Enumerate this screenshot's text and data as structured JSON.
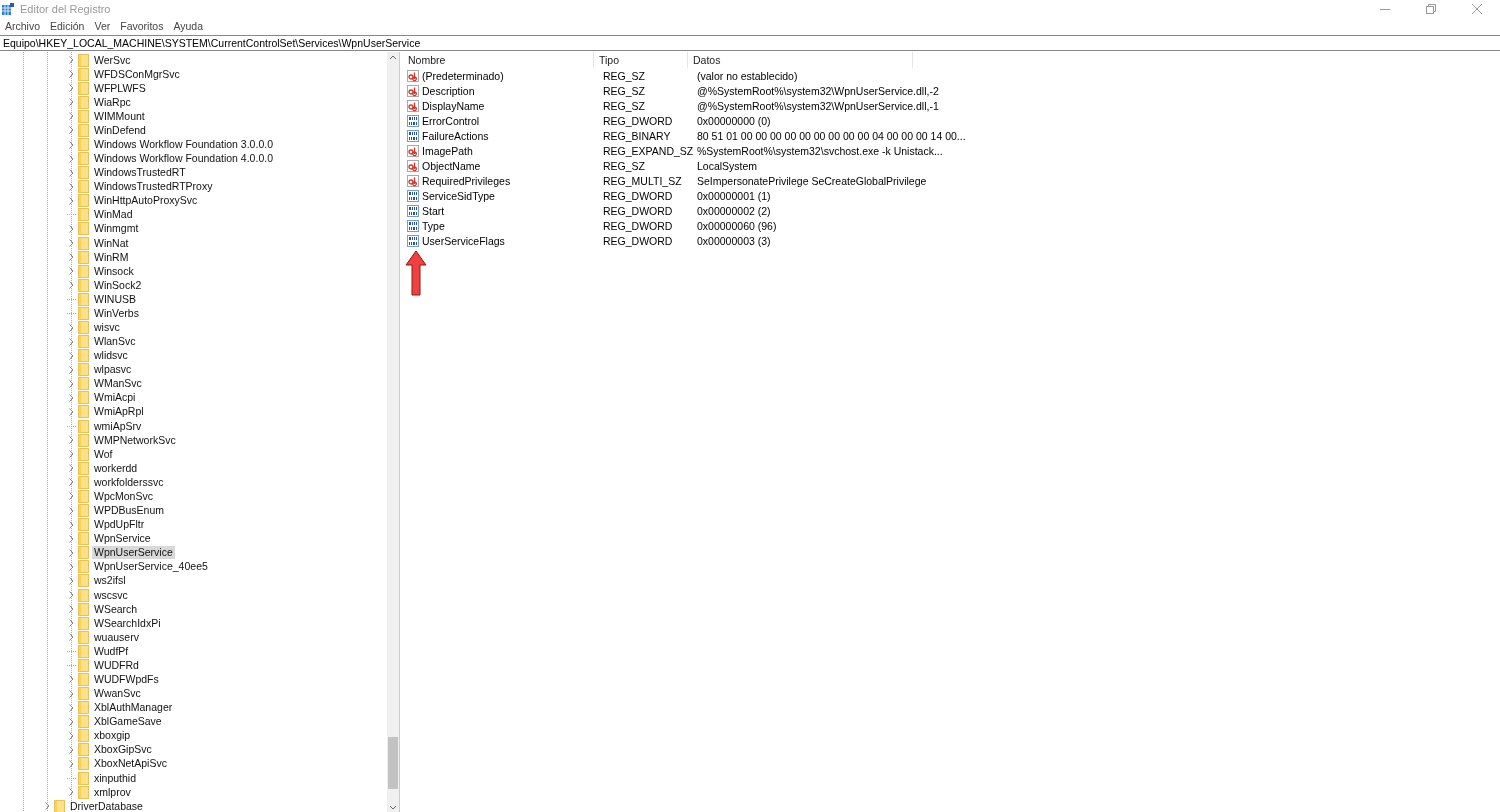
{
  "window": {
    "title": "Editor del Registro"
  },
  "menu": [
    "Archivo",
    "Edición",
    "Ver",
    "Favoritos",
    "Ayuda"
  ],
  "address": "Equipo\\HKEY_LOCAL_MACHINE\\SYSTEM\\CurrentControlSet\\Services\\WpnUserService",
  "tree": [
    {
      "children": [
        {
          "label": "WerSvc",
          "expandable": true,
          "selected": false
        },
        {
          "label": "WFDSConMgrSvc",
          "expandable": true,
          "selected": false
        },
        {
          "label": "WFPLWFS",
          "expandable": true,
          "selected": false
        },
        {
          "label": "WiaRpc",
          "expandable": true,
          "selected": false
        },
        {
          "label": "WIMMount",
          "expandable": true,
          "selected": false
        },
        {
          "label": "WinDefend",
          "expandable": true,
          "selected": false
        },
        {
          "label": "Windows Workflow Foundation 3.0.0.0",
          "expandable": true,
          "selected": false
        },
        {
          "label": "Windows Workflow Foundation 4.0.0.0",
          "expandable": true,
          "selected": false
        },
        {
          "label": "WindowsTrustedRT",
          "expandable": true,
          "selected": false
        },
        {
          "label": "WindowsTrustedRTProxy",
          "expandable": true,
          "selected": false
        },
        {
          "label": "WinHttpAutoProxySvc",
          "expandable": true,
          "selected": false
        },
        {
          "label": "WinMad",
          "expandable": false,
          "selected": false
        },
        {
          "label": "Winmgmt",
          "expandable": true,
          "selected": false
        },
        {
          "label": "WinNat",
          "expandable": true,
          "selected": false
        },
        {
          "label": "WinRM",
          "expandable": true,
          "selected": false
        },
        {
          "label": "Winsock",
          "expandable": true,
          "selected": false
        },
        {
          "label": "WinSock2",
          "expandable": true,
          "selected": false
        },
        {
          "label": "WINUSB",
          "expandable": false,
          "selected": false
        },
        {
          "label": "WinVerbs",
          "expandable": false,
          "selected": false
        },
        {
          "label": "wisvc",
          "expandable": true,
          "selected": false
        },
        {
          "label": "WlanSvc",
          "expandable": true,
          "selected": false
        },
        {
          "label": "wlidsvc",
          "expandable": true,
          "selected": false
        },
        {
          "label": "wlpasvc",
          "expandable": true,
          "selected": false
        },
        {
          "label": "WManSvc",
          "expandable": true,
          "selected": false
        },
        {
          "label": "WmiAcpi",
          "expandable": true,
          "selected": false
        },
        {
          "label": "WmiApRpl",
          "expandable": true,
          "selected": false
        },
        {
          "label": "wmiApSrv",
          "expandable": false,
          "selected": false
        },
        {
          "label": "WMPNetworkSvc",
          "expandable": true,
          "selected": false
        },
        {
          "label": "Wof",
          "expandable": true,
          "selected": false
        },
        {
          "label": "workerdd",
          "expandable": true,
          "selected": false
        },
        {
          "label": "workfolderssvc",
          "expandable": true,
          "selected": false
        },
        {
          "label": "WpcMonSvc",
          "expandable": true,
          "selected": false
        },
        {
          "label": "WPDBusEnum",
          "expandable": true,
          "selected": false
        },
        {
          "label": "WpdUpFltr",
          "expandable": true,
          "selected": false
        },
        {
          "label": "WpnService",
          "expandable": true,
          "selected": false
        },
        {
          "label": "WpnUserService",
          "expandable": true,
          "selected": true
        },
        {
          "label": "WpnUserService_40ee5",
          "expandable": true,
          "selected": false
        },
        {
          "label": "ws2ifsl",
          "expandable": true,
          "selected": false
        },
        {
          "label": "wscsvc",
          "expandable": true,
          "selected": false
        },
        {
          "label": "WSearch",
          "expandable": true,
          "selected": false
        },
        {
          "label": "WSearchIdxPi",
          "expandable": true,
          "selected": false
        },
        {
          "label": "wuauserv",
          "expandable": true,
          "selected": false
        },
        {
          "label": "WudfPf",
          "expandable": false,
          "selected": false
        },
        {
          "label": "WUDFRd",
          "expandable": false,
          "selected": false
        },
        {
          "label": "WUDFWpdFs",
          "expandable": true,
          "selected": false
        },
        {
          "label": "WwanSvc",
          "expandable": true,
          "selected": false
        },
        {
          "label": "XblAuthManager",
          "expandable": true,
          "selected": false
        },
        {
          "label": "XblGameSave",
          "expandable": true,
          "selected": false
        },
        {
          "label": "xboxgip",
          "expandable": true,
          "selected": false
        },
        {
          "label": "XboxGipSvc",
          "expandable": true,
          "selected": false
        },
        {
          "label": "XboxNetApiSvc",
          "expandable": true,
          "selected": false
        },
        {
          "label": "xinputhid",
          "expandable": false,
          "selected": false
        },
        {
          "label": "xmlprov",
          "expandable": true,
          "selected": false
        }
      ]
    },
    {
      "label": "DriverDatabase",
      "expandable": true,
      "selected": false
    }
  ],
  "table": {
    "columns": [
      "Nombre",
      "Tipo",
      "Datos"
    ],
    "rows": [
      {
        "kind": "string",
        "name": "(Predeterminado)",
        "type": "REG_SZ",
        "data": "(valor no establecido)"
      },
      {
        "kind": "string",
        "name": "Description",
        "type": "REG_SZ",
        "data": "@%SystemRoot%\\system32\\WpnUserService.dll,-2"
      },
      {
        "kind": "string",
        "name": "DisplayName",
        "type": "REG_SZ",
        "data": "@%SystemRoot%\\system32\\WpnUserService.dll,-1"
      },
      {
        "kind": "binary",
        "name": "ErrorControl",
        "type": "REG_DWORD",
        "data": "0x00000000 (0)"
      },
      {
        "kind": "binary",
        "name": "FailureActions",
        "type": "REG_BINARY",
        "data": "80 51 01 00 00 00 00 00 00 00 00 00 04 00 00 00 14 00..."
      },
      {
        "kind": "string",
        "name": "ImagePath",
        "type": "REG_EXPAND_SZ",
        "data": "%SystemRoot%\\system32\\svchost.exe -k Unistack..."
      },
      {
        "kind": "string",
        "name": "ObjectName",
        "type": "REG_SZ",
        "data": "LocalSystem"
      },
      {
        "kind": "string",
        "name": "RequiredPrivileges",
        "type": "REG_MULTI_SZ",
        "data": "SeImpersonatePrivilege SeCreateGlobalPrivilege"
      },
      {
        "kind": "binary",
        "name": "ServiceSidType",
        "type": "REG_DWORD",
        "data": "0x00000001 (1)"
      },
      {
        "kind": "binary",
        "name": "Start",
        "type": "REG_DWORD",
        "data": "0x00000002 (2)"
      },
      {
        "kind": "binary",
        "name": "Type",
        "type": "REG_DWORD",
        "data": "0x00000060 (96)"
      },
      {
        "kind": "binary",
        "name": "UserServiceFlags",
        "type": "REG_DWORD",
        "data": "0x00000003 (3)"
      }
    ]
  }
}
